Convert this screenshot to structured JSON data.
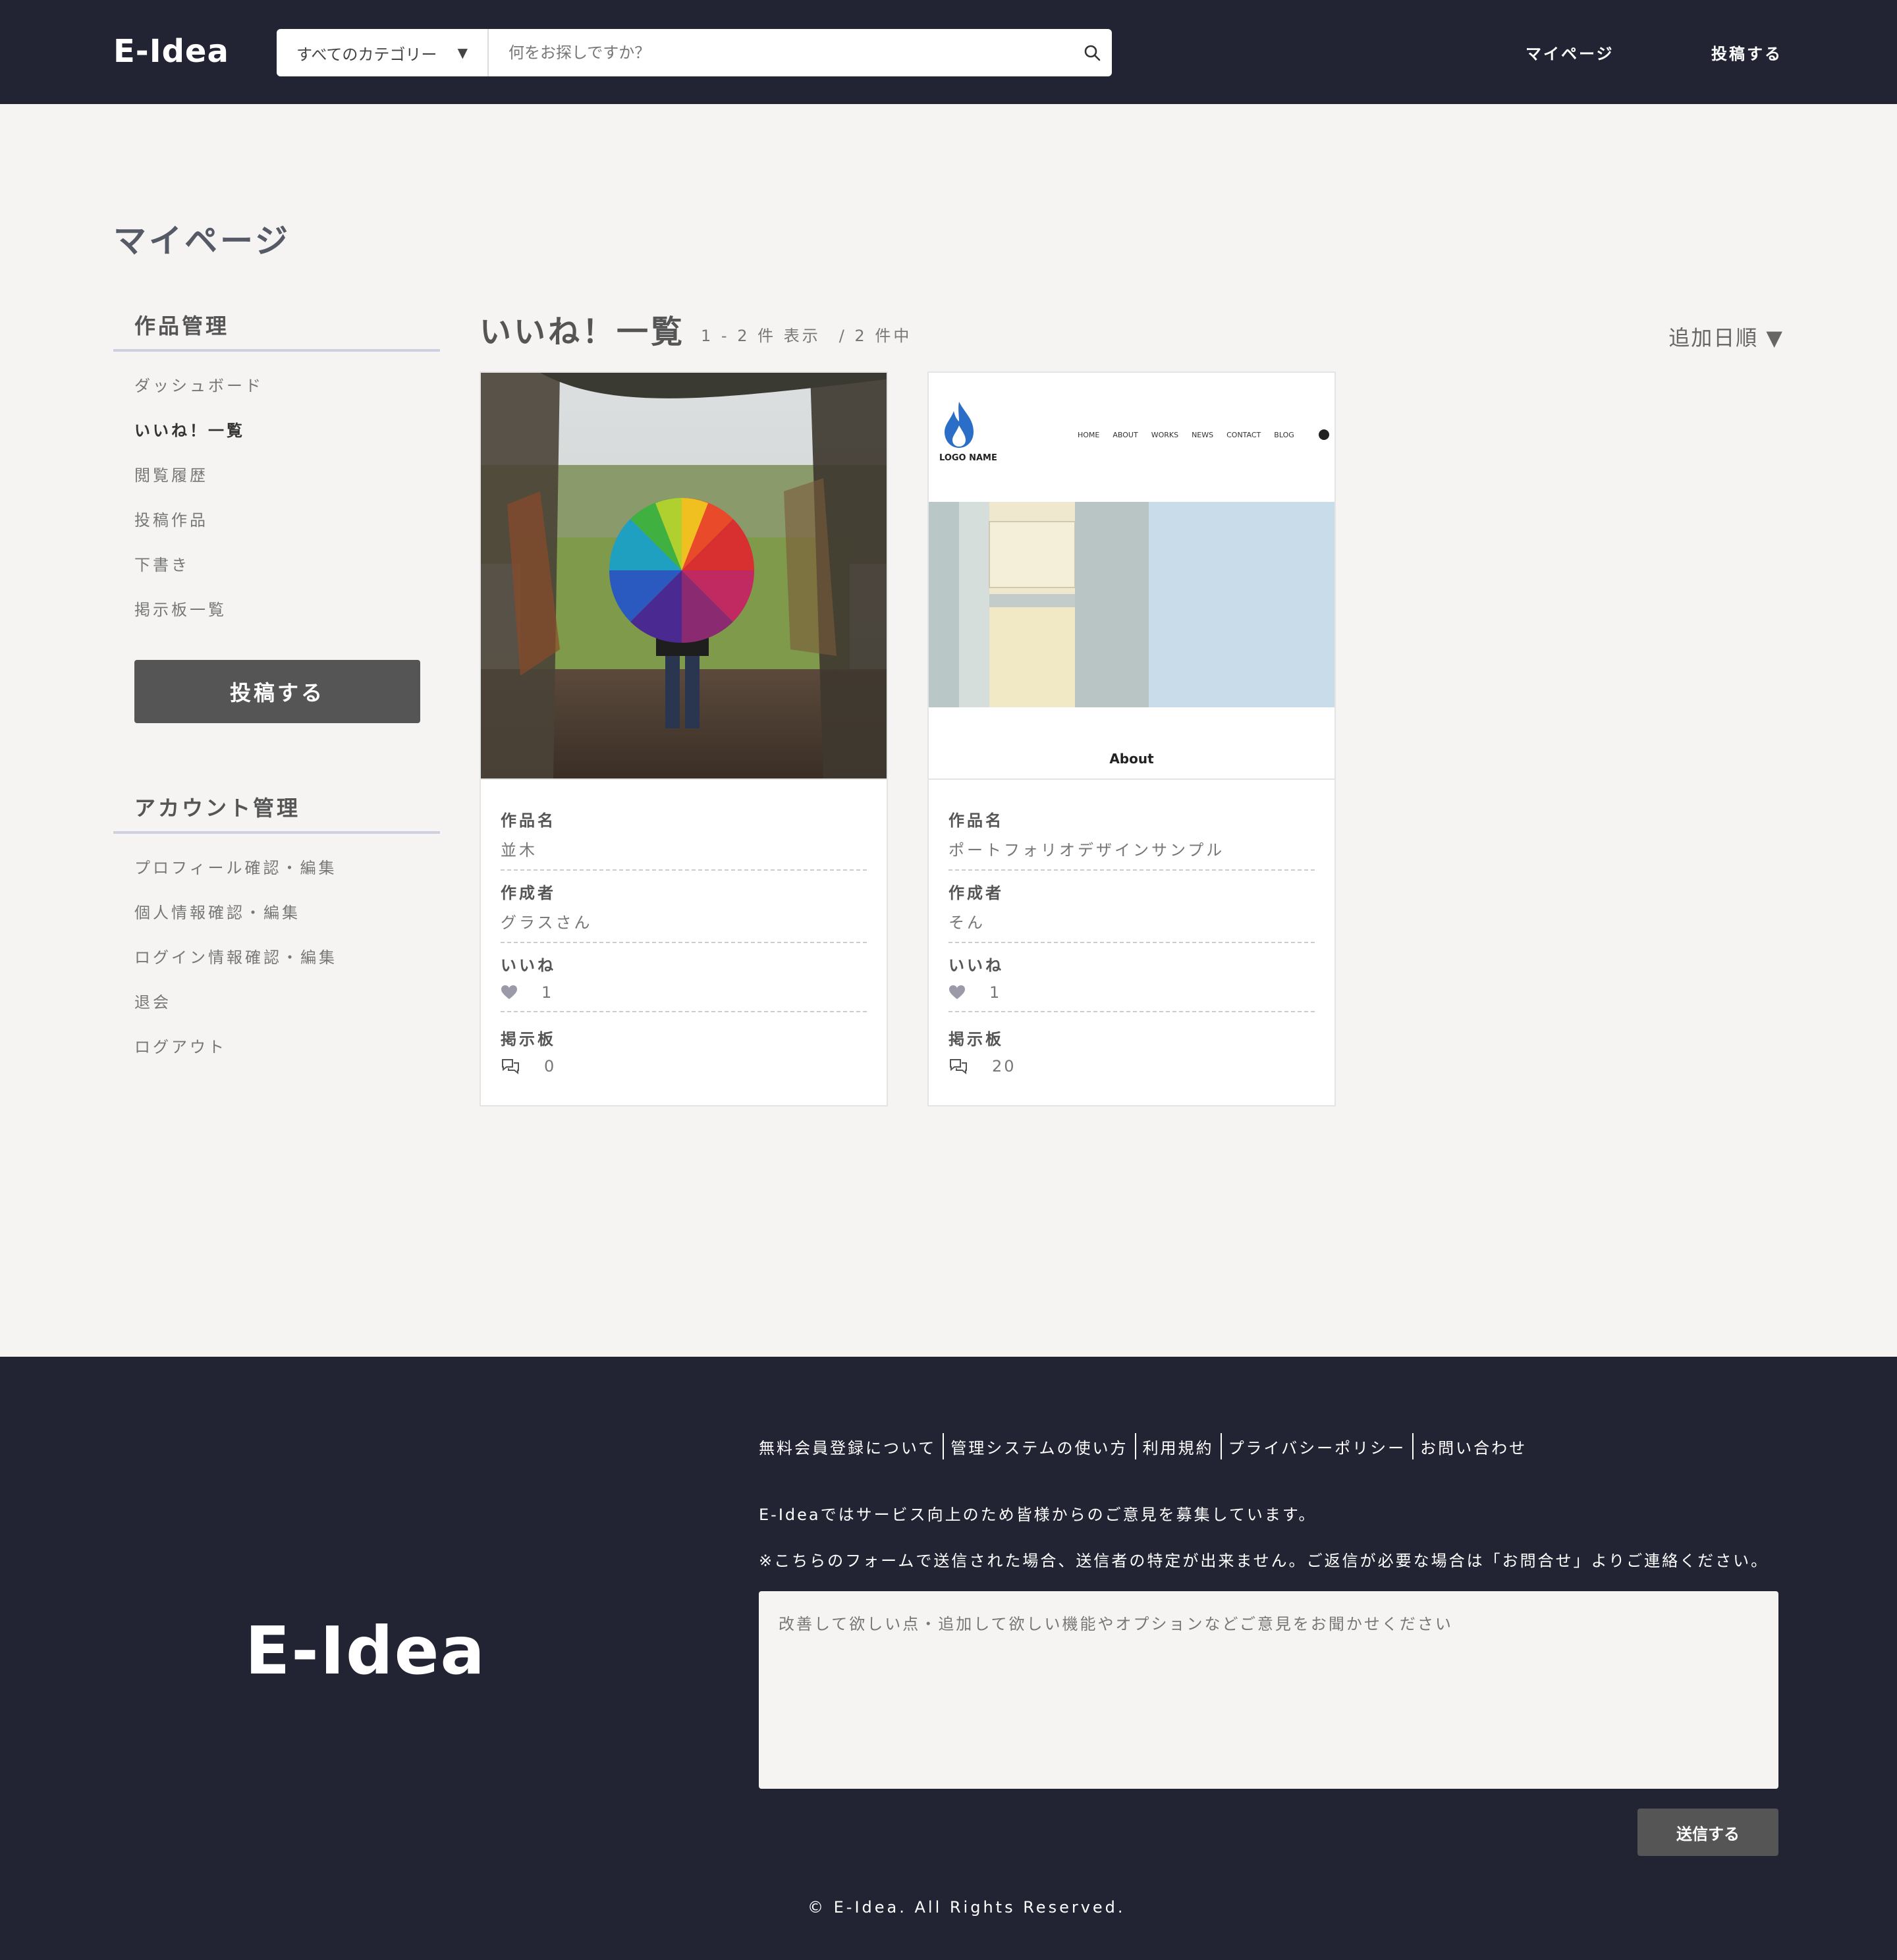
{
  "header": {
    "logo": "E-Idea",
    "category_select": "すべてのカテゴリー",
    "search_placeholder": "何をお探しですか？",
    "nav": [
      "マイページ",
      "投稿する"
    ]
  },
  "page_title": "マイページ",
  "sidebar": {
    "section1_title": "作品管理",
    "section1_items": [
      "ダッシュボード",
      "いいね！一覧",
      "閲覧履歴",
      "投稿作品",
      "下書き",
      "掲示板一覧"
    ],
    "active_item": "いいね！一覧",
    "post_button": "投稿する",
    "section2_title": "アカウント管理",
    "section2_items": [
      "プロフィール確認・編集",
      "個人情報確認・編集",
      "ログイン情報確認・編集",
      "退会",
      "ログアウト"
    ]
  },
  "main": {
    "title": "いいね！一覧",
    "count": "1 - 2 件 表示　/ 2 件中",
    "sort": "追加日順 ▼",
    "cards": [
      {
        "work_label": "作品名",
        "work": "並木",
        "author_label": "作成者",
        "author": "グラスさん",
        "likes_label": "いいね",
        "likes": "1",
        "board_label": "掲示板",
        "board": "0"
      },
      {
        "work_label": "作品名",
        "work": "ポートフォリオデザインサンプル",
        "author_label": "作成者",
        "author": "そん",
        "likes_label": "いいね",
        "likes": "1",
        "board_label": "掲示板",
        "board": "20",
        "preview": {
          "logo": "LOGO NAME",
          "nav": [
            "HOME",
            "ABOUT",
            "WORKS",
            "NEWS",
            "CONTACT",
            "BLOG"
          ],
          "section": "About"
        }
      }
    ]
  },
  "footer": {
    "logo": "E-Idea",
    "links": [
      "無料会員登録について",
      "管理システムの使い方",
      "利用規約",
      "プライバシーポリシー",
      "お問い合わせ"
    ],
    "text1": "E-Ideaではサービス向上のため皆様からのご意見を募集しています。",
    "text2": "※こちらのフォームで送信された場合、送信者の特定が出来ません。ご返信が必要な場合は「お問合せ」よりご連絡ください。",
    "textarea_placeholder": "改善して欲しい点・追加して欲しい機能やオプションなどご意見をお聞かせください",
    "submit": "送信する",
    "copyright": "© E-Idea. All Rights Reserved."
  },
  "colors": {
    "dark": "#222433",
    "accent": "#555555",
    "heart": "#9a9aa8"
  }
}
